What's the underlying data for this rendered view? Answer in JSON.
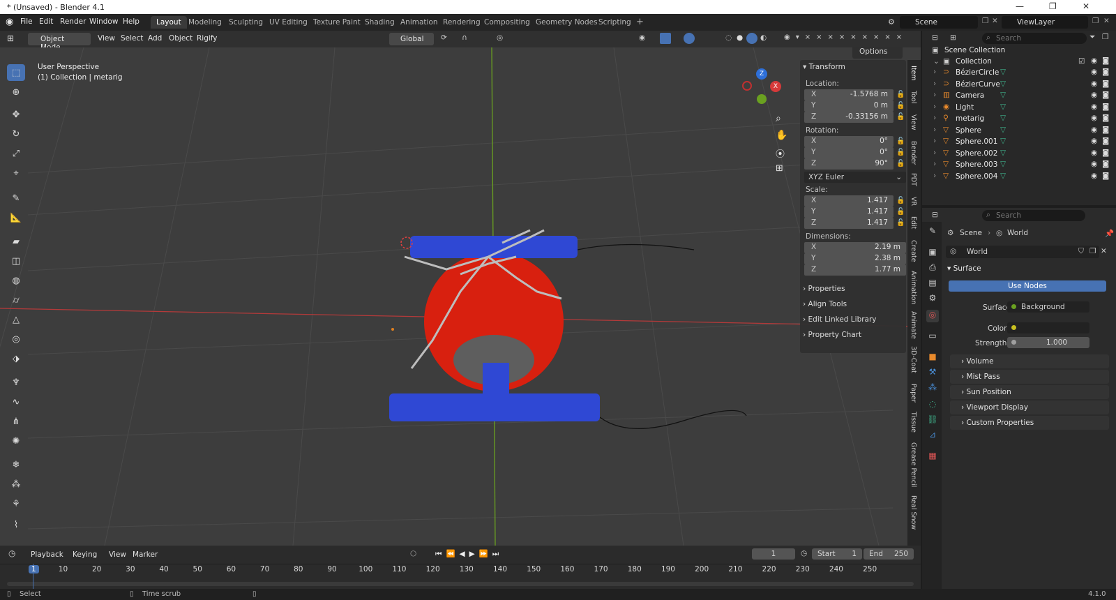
{
  "window": {
    "title": "* (Unsaved) - Blender 4.1",
    "controls": [
      "—",
      "❐",
      "✕"
    ]
  },
  "menu": {
    "items": [
      "File",
      "Edit",
      "Render",
      "Window",
      "Help"
    ]
  },
  "workspaces": {
    "tabs": [
      "Layout",
      "Modeling",
      "Sculpting",
      "UV Editing",
      "Texture Paint",
      "Shading",
      "Animation",
      "Rendering",
      "Compositing",
      "Geometry Nodes",
      "Scripting"
    ],
    "active": "Layout",
    "add": "+"
  },
  "scene": {
    "name": "Scene",
    "view_layer": "ViewLayer"
  },
  "viewport_header": {
    "mode": "Object Mode",
    "menus": [
      "View",
      "Select",
      "Add",
      "Object",
      "Rigify"
    ],
    "transform_orientation": "Global",
    "options": "Options"
  },
  "viewport": {
    "perspective": "User Perspective",
    "collection_info": "(1) Collection | metarig",
    "gizmo": {
      "z": "Z",
      "y": "Y",
      "x": "X"
    }
  },
  "n_panel": {
    "transform_title": "Transform",
    "location_label": "Location:",
    "location": [
      {
        "axis": "X",
        "value": "-1.5768 m"
      },
      {
        "axis": "Y",
        "value": "0 m"
      },
      {
        "axis": "Z",
        "value": "-0.33156 m"
      }
    ],
    "rotation_label": "Rotation:",
    "rotation": [
      {
        "axis": "X",
        "value": "0°"
      },
      {
        "axis": "Y",
        "value": "0°"
      },
      {
        "axis": "Z",
        "value": "90°"
      }
    ],
    "rotation_mode": "XYZ Euler",
    "scale_label": "Scale:",
    "scale": [
      {
        "axis": "X",
        "value": "1.417"
      },
      {
        "axis": "Y",
        "value": "1.417"
      },
      {
        "axis": "Z",
        "value": "1.417"
      }
    ],
    "dimensions_label": "Dimensions:",
    "dimensions": [
      {
        "axis": "X",
        "value": "2.19 m"
      },
      {
        "axis": "Y",
        "value": "2.38 m"
      },
      {
        "axis": "Z",
        "value": "1.77 m"
      }
    ],
    "sections": [
      "Properties",
      "Align Tools",
      "Edit Linked Library",
      "Property Chart"
    ]
  },
  "n_tabs": [
    "Item",
    "Tool",
    "View",
    "Bender",
    "PDT",
    "VR",
    "Edit",
    "Create",
    "Animation",
    "Animate",
    "3D-Coat",
    "Paper",
    "Tissue",
    "Grease Pencil",
    "Real Snow"
  ],
  "outliner": {
    "search_placeholder": "Search",
    "scene_collection": "Scene Collection",
    "collection": "Collection",
    "objects": [
      "BézierCircle",
      "BézierCurve",
      "Camera",
      "Light",
      "metarig",
      "Sphere",
      "Sphere.001",
      "Sphere.002",
      "Sphere.003",
      "Sphere.004"
    ]
  },
  "properties": {
    "search_placeholder": "Search",
    "breadcrumb": [
      "Scene",
      "World"
    ],
    "world_name": "World",
    "surface_section": "Surface",
    "use_nodes": "Use Nodes",
    "surface_label": "Surface",
    "surface_value": "Background",
    "color_label": "Color",
    "strength_label": "Strength",
    "strength_value": "1.000",
    "sections": [
      "Volume",
      "Mist Pass",
      "Sun Position",
      "Viewport Display",
      "Custom Properties"
    ]
  },
  "timeline": {
    "menus": [
      "Playback",
      "Keying",
      "View",
      "Marker"
    ],
    "current_frame": "1",
    "start_label": "Start",
    "start": "1",
    "end_label": "End",
    "end": "250",
    "ticks": [
      "1",
      "10",
      "20",
      "30",
      "40",
      "50",
      "60",
      "70",
      "80",
      "90",
      "100",
      "110",
      "120",
      "130",
      "140",
      "150",
      "160",
      "170",
      "180",
      "190",
      "200",
      "210",
      "220",
      "230",
      "240",
      "250"
    ]
  },
  "statusbar": {
    "select": "Select",
    "time_scrub": "Time scrub",
    "version": "4.1.0"
  },
  "colors": {
    "accent": "#4772b3",
    "sphere": "#d8200f",
    "cylinders": "#2f48d4",
    "x_axis": "#b43a3a",
    "y_axis": "#6aa120"
  }
}
